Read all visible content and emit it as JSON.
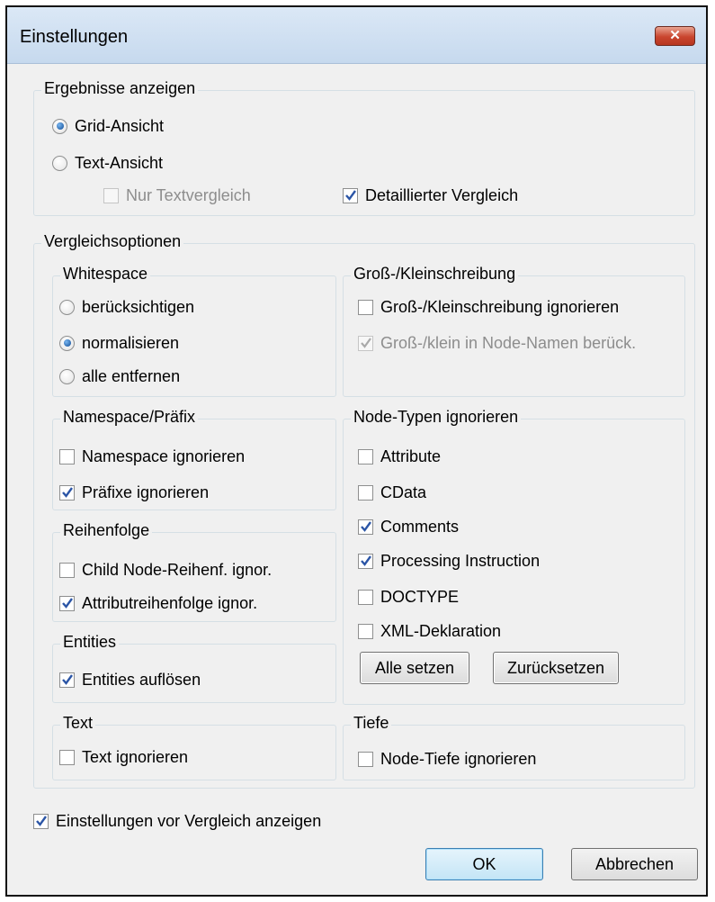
{
  "dialog": {
    "title": "Einstellungen",
    "close_symbol": "✕"
  },
  "results": {
    "legend": "Ergebnisse anzeigen",
    "grid_view": "Grid-Ansicht",
    "text_view": "Text-Ansicht",
    "text_only": "Nur Textvergleich",
    "detailed": "Detaillierter Vergleich",
    "selected": "grid"
  },
  "compare": {
    "legend": "Vergleichsoptionen",
    "whitespace": {
      "legend": "Whitespace",
      "consider": "berücksichtigen",
      "normalize": "normalisieren",
      "remove_all": "alle entfernen",
      "selected": "normalize"
    },
    "case": {
      "legend": "Groß-/Kleinschreibung",
      "ignore_case": "Groß-/Kleinschreibung ignorieren",
      "node_names": "Groß-/klein in Node-Namen berück."
    },
    "namespace": {
      "legend": "Namespace/Präfix",
      "ignore_namespace": "Namespace ignorieren",
      "ignore_prefix": "Präfixe ignorieren"
    },
    "node_types": {
      "legend": "Node-Typen ignorieren",
      "attribute": "Attribute",
      "cdata": "CData",
      "comments": "Comments",
      "processing": "Processing Instruction",
      "doctype": "DOCTYPE",
      "xml_decl": "XML-Deklaration",
      "set_all": "Alle setzen",
      "reset": "Zurücksetzen"
    },
    "order": {
      "legend": "Reihenfolge",
      "child_order": "Child Node-Reihenf. ignor.",
      "attr_order": "Attributreihenfolge ignor."
    },
    "entities": {
      "legend": "Entities",
      "resolve": "Entities auflösen"
    },
    "text": {
      "legend": "Text",
      "ignore_text": "Text ignorieren"
    },
    "depth": {
      "legend": "Tiefe",
      "ignore_depth": "Node-Tiefe ignorieren"
    }
  },
  "footer": {
    "show_before": "Einstellungen vor Vergleich anzeigen",
    "ok": "OK",
    "cancel": "Abbrechen"
  },
  "icons": {
    "check": "checkmark-icon",
    "close": "close-icon"
  }
}
